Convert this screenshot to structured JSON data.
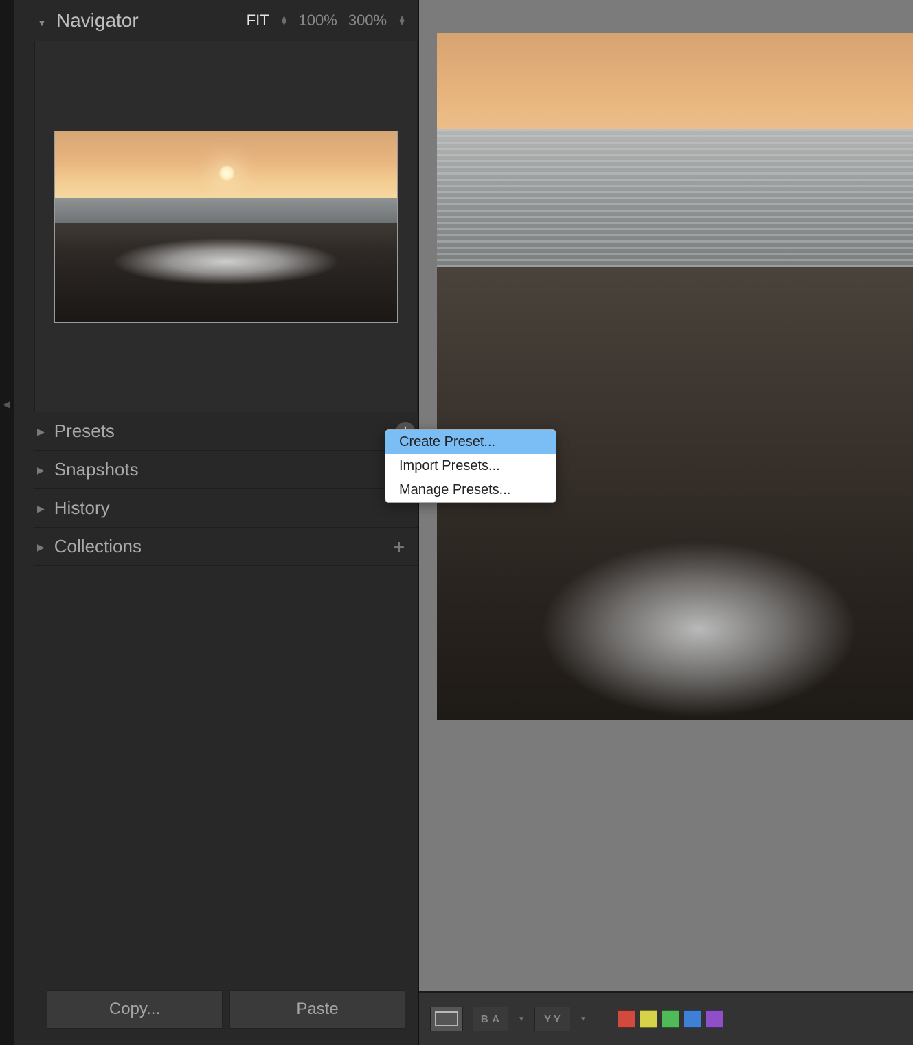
{
  "navigator": {
    "title": "Navigator",
    "zoom": {
      "fit": "FIT",
      "p100": "100%",
      "p300": "300%"
    }
  },
  "panels": {
    "presets": "Presets",
    "snapshots": "Snapshots",
    "history": "History",
    "collections": "Collections"
  },
  "buttons": {
    "copy": "Copy...",
    "paste": "Paste"
  },
  "context_menu": {
    "create": "Create Preset...",
    "import": "Import Presets...",
    "manage": "Manage Presets..."
  },
  "toolbar": {
    "ba_label": "B A",
    "yy_label": "Y Y"
  },
  "colors": {
    "red": "#d24a3e",
    "yellow": "#d6d24a",
    "green": "#4fba57",
    "blue": "#3f7fd6",
    "purple": "#8f4fc9"
  }
}
